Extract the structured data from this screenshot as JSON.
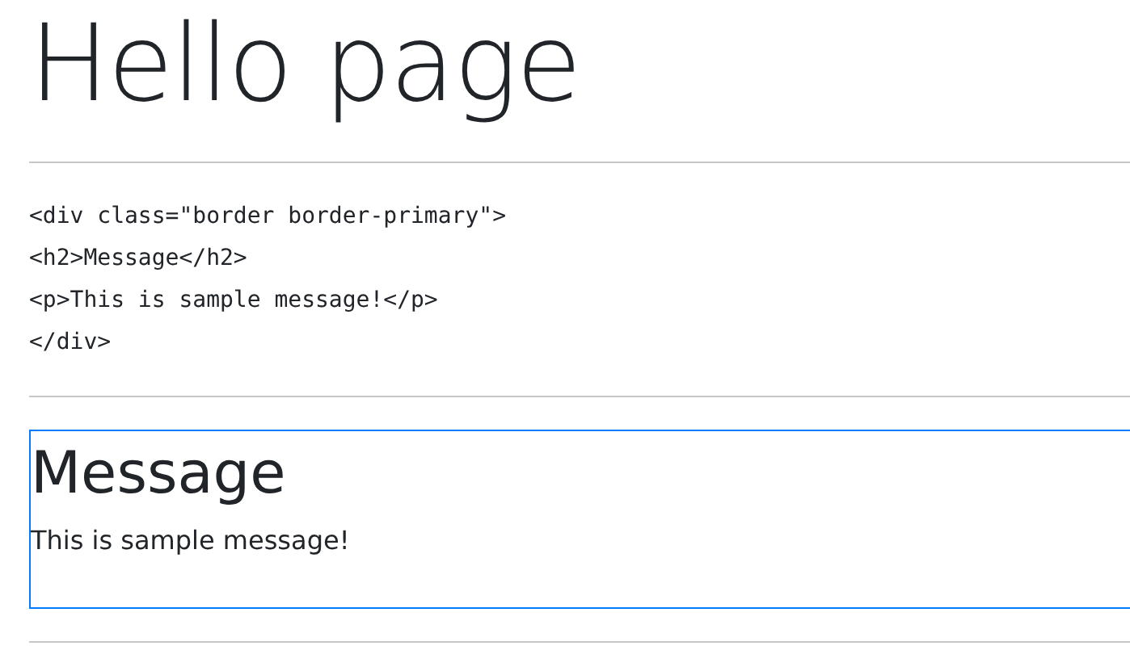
{
  "page_title": "Hello page",
  "code_lines": [
    "<div class=\"border border-primary\">",
    "<h2>Message</h2>",
    "<p>This is sample message!</p>",
    "</div>"
  ],
  "message_box": {
    "heading": "Message",
    "text": "This is sample message!"
  }
}
